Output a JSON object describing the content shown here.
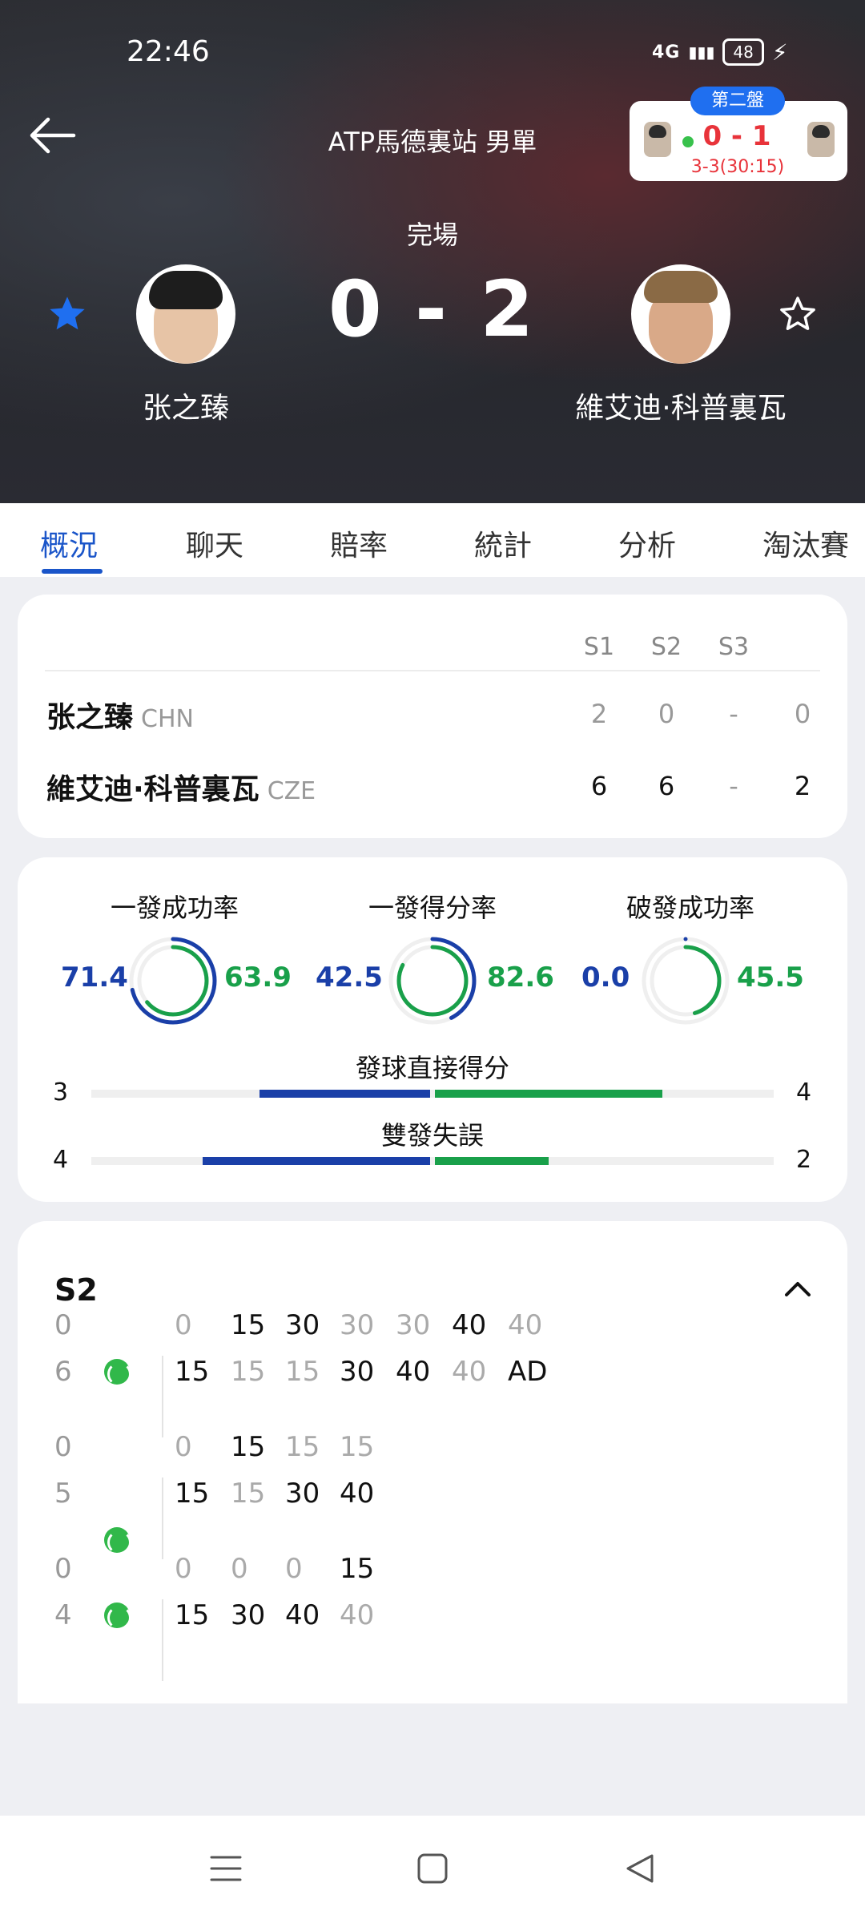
{
  "status_bar": {
    "time": "22:46",
    "network": "4G",
    "battery": "48"
  },
  "header": {
    "title": "ATP馬德裏站 男單",
    "match_status": "完場",
    "score": "0 - 2",
    "player_left": "张之臻",
    "player_right": "維艾迪·科普裏瓦"
  },
  "mini_widget": {
    "tag": "第二盤",
    "score": "0 - 1",
    "sub": "3-3(30:15)"
  },
  "tabs": [
    "概況",
    "聊天",
    "賠率",
    "統計",
    "分析",
    "淘汰賽"
  ],
  "set_table": {
    "headers": [
      "S1",
      "S2",
      "S3"
    ],
    "rows": [
      {
        "name": "张之臻",
        "code": "CHN",
        "sets": [
          "2",
          "0",
          "-"
        ],
        "total": "0"
      },
      {
        "name": "維艾迪·科普裏瓦",
        "code": "CZE",
        "sets": [
          "6",
          "6",
          "-"
        ],
        "total": "2"
      }
    ]
  },
  "stats": {
    "rings": [
      {
        "label": "一發成功率",
        "left": "71.4",
        "right": "63.9",
        "left_pct": 71.4,
        "right_pct": 63.9
      },
      {
        "label": "一發得分率",
        "left": "42.5",
        "right": "82.6",
        "left_pct": 42.5,
        "right_pct": 82.6
      },
      {
        "label": "破發成功率",
        "left": "0.0",
        "right": "45.5",
        "left_pct": 0.0,
        "right_pct": 45.5
      }
    ],
    "bars": [
      {
        "label": "發球直接得分",
        "left": "3",
        "right": "4",
        "left_val": 3,
        "right_val": 4
      },
      {
        "label": "雙發失誤",
        "left": "4",
        "right": "2",
        "left_val": 4,
        "right_val": 2
      }
    ],
    "colors": {
      "left": "#1a3fa8",
      "right": "#19a04a"
    }
  },
  "games": {
    "set_label": "S2",
    "blocks": [
      {
        "top_game": "0",
        "bottom_game": "6",
        "top_points": [
          "0",
          "15",
          "30",
          "30",
          "30",
          "40",
          "40"
        ],
        "bottom_points": [
          "15",
          "15",
          "15",
          "30",
          "40",
          "40",
          "AD"
        ]
      },
      {
        "top_game": "0",
        "bottom_game": "5",
        "top_points": [
          "0",
          "15",
          "15",
          "15"
        ],
        "bottom_points": [
          "15",
          "15",
          "30",
          "40"
        ]
      },
      {
        "top_game": "0",
        "bottom_game": "4",
        "top_points": [
          "0",
          "0",
          "0",
          "15"
        ],
        "bottom_points": [
          "15",
          "30",
          "40",
          "40"
        ]
      }
    ]
  }
}
